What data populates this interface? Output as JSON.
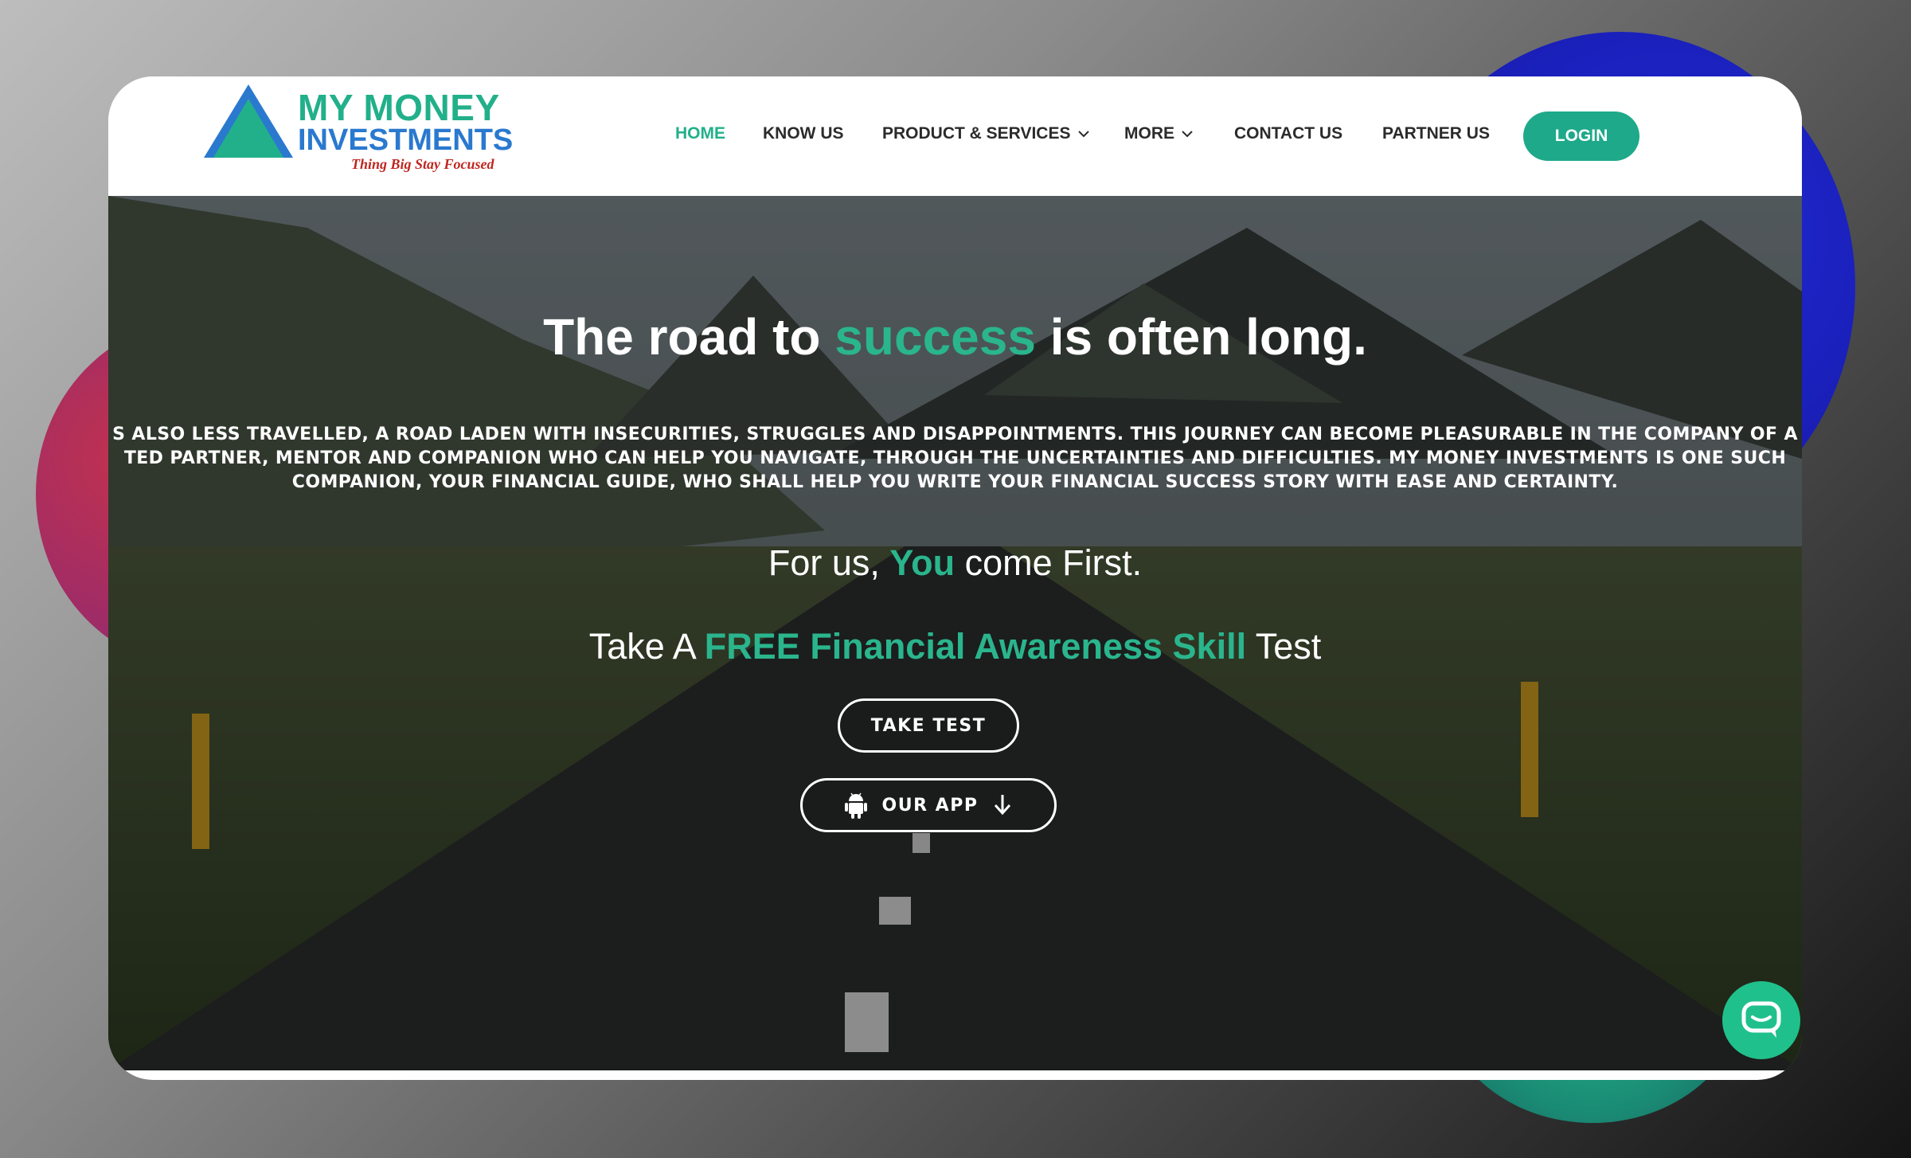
{
  "brand": {
    "name_line1": "MY MONEY",
    "name_line2": "INVESTMENTS",
    "tagline": "Thing Big Stay Focused"
  },
  "nav": {
    "items": [
      {
        "label": "HOME",
        "active": true
      },
      {
        "label": "KNOW US"
      },
      {
        "label": "PRODUCT & SERVICES",
        "dropdown": true
      },
      {
        "label": "MORE",
        "dropdown": true
      },
      {
        "label": "CONTACT US"
      },
      {
        "label": "PARTNER US"
      }
    ],
    "login_label": "LOGIN"
  },
  "hero": {
    "headline_pre": "The road to ",
    "headline_accent": "success",
    "headline_post": " is often long.",
    "paragraph_lines": [
      "S ALSO LESS TRAVELLED, A ROAD LADEN WITH INSECURITIES, STRUGGLES AND DISAPPOINTMENTS. THIS JOURNEY CAN BECOME PLEASURABLE IN THE COMPANY OF A",
      "TED PARTNER, MENTOR AND COMPANION WHO CAN HELP YOU NAVIGATE, THROUGH THE UNCERTAINTIES AND DIFFICULTIES. MY MONEY INVESTMENTS IS ONE SUCH",
      "COMPANION, YOUR FINANCIAL GUIDE, WHO SHALL HELP YOU WRITE YOUR FINANCIAL SUCCESS STORY WITH EASE AND CERTAINTY."
    ],
    "tagline_pre": "For us, ",
    "tagline_accent": "You",
    "tagline_post": " come First.",
    "test_pre": "Take A ",
    "test_accent": "FREE Financial Awareness Skill",
    "test_post": " Test",
    "take_test_label": "TAKE TEST",
    "our_app_label": "OUR APP"
  },
  "colors": {
    "accent": "#22b08a",
    "login_bg": "#1ea98a",
    "chat_bg": "#20c08c"
  }
}
